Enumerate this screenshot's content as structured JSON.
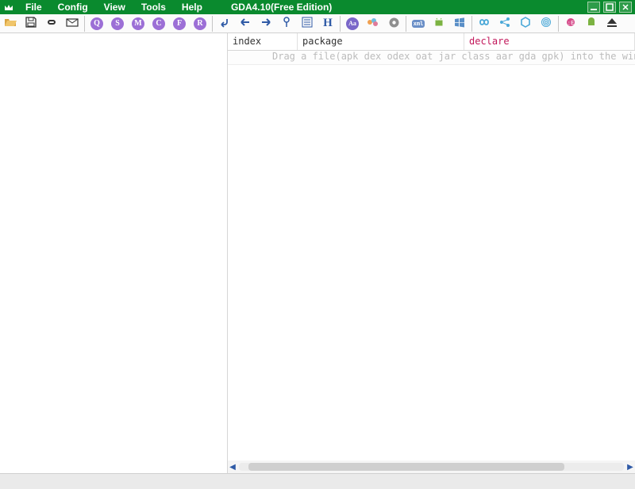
{
  "app": {
    "title": "GDA4.10(Free Edition)"
  },
  "menu": {
    "items": [
      "File",
      "Config",
      "View",
      "Tools",
      "Help"
    ]
  },
  "toolbar": {
    "groups": [
      [
        "open",
        "save",
        "link",
        "clipboard"
      ],
      [
        "search-q",
        "search-s",
        "search-m",
        "search-c",
        "search-f",
        "search-r"
      ],
      [
        "nav-return",
        "nav-back",
        "nav-forward",
        "bookmark",
        "list",
        "heading"
      ],
      [
        "text-style",
        "palette",
        "settings"
      ],
      [
        "xml",
        "android",
        "windows"
      ],
      [
        "infinity",
        "share",
        "hexagon",
        "fingerprint"
      ],
      [
        "ellipsis",
        "android2",
        "eject"
      ]
    ],
    "circle_letters": {
      "search-q": "Q",
      "search-s": "S",
      "search-m": "M",
      "search-c": "C",
      "search-f": "F",
      "search-r": "R"
    },
    "xml_label": "xml"
  },
  "headers": {
    "col1": "index",
    "col2": "package",
    "col3": "declare"
  },
  "hint": "Drag a file(apk dex odex oat jar class aar gda gpk) into the window for dec",
  "colors": {
    "menubar": "#0a8a2e",
    "purple": "#9c6fd6",
    "blue": "#2f5aa6",
    "keyword": "#c2185b"
  }
}
